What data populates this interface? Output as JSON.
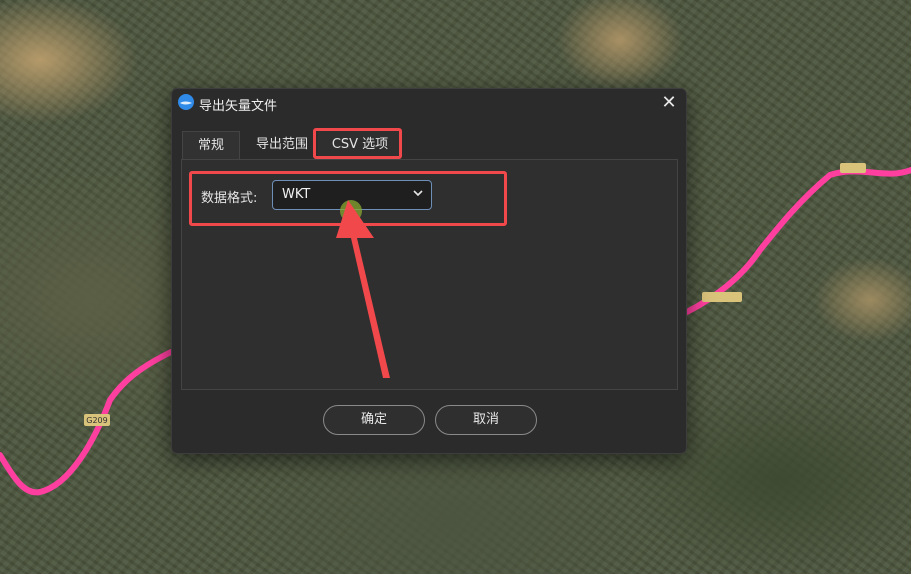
{
  "dialog": {
    "title": "导出矢量文件",
    "close_glyph": "✕",
    "tabs": [
      {
        "label": "常规"
      },
      {
        "label": "导出范围"
      },
      {
        "label": "CSV 选项",
        "selected": true
      }
    ],
    "data_format": {
      "label": "数据格式:",
      "value": "WKT"
    },
    "buttons": {
      "ok": "确定",
      "cancel": "取消"
    }
  },
  "map": {
    "road_shield_left": "G209",
    "road_color": "#ff3fa0"
  },
  "icons": [
    "app-logo-icon",
    "close-icon",
    "chevron-down-icon"
  ],
  "colors": {
    "highlight": "#f1484b",
    "dialog_bg": "#2b2b2b",
    "focus_border": "#6d8fb8"
  }
}
